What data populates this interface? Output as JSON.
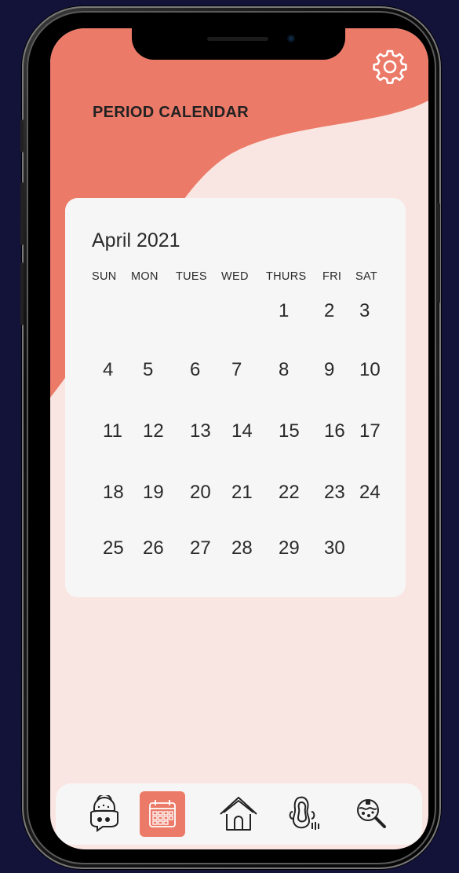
{
  "app": {
    "title": "PERIOD CALENDAR"
  },
  "calendar": {
    "month_label": "April 2021",
    "weekdays": [
      "SUN",
      "MON",
      "TUES",
      "WED",
      "THURS",
      "FRI",
      "SAT"
    ],
    "weeks": [
      [
        "",
        "",
        "",
        "",
        "1",
        "2",
        "3"
      ],
      [
        "4",
        "5",
        "6",
        "7",
        "8",
        "9",
        "10"
      ],
      [
        "11",
        "12",
        "13",
        "14",
        "15",
        "16",
        "17"
      ],
      [
        "18",
        "19",
        "20",
        "21",
        "22",
        "23",
        "24"
      ],
      [
        "25",
        "26",
        "27",
        "28",
        "29",
        "30",
        ""
      ]
    ]
  },
  "nav": {
    "items": [
      {
        "icon": "chat-bubbles-icon",
        "active": false
      },
      {
        "icon": "calendar-icon",
        "active": true
      },
      {
        "icon": "home-icon",
        "active": false
      },
      {
        "icon": "pad-icon",
        "active": false
      },
      {
        "icon": "search-germ-icon",
        "active": false
      }
    ]
  },
  "header": {
    "settings_icon": "gear-icon"
  },
  "colors": {
    "accent": "#ec7a68",
    "background": "#f9e6e2",
    "card": "#f6f6f6",
    "frame_bg": "#13133a"
  }
}
